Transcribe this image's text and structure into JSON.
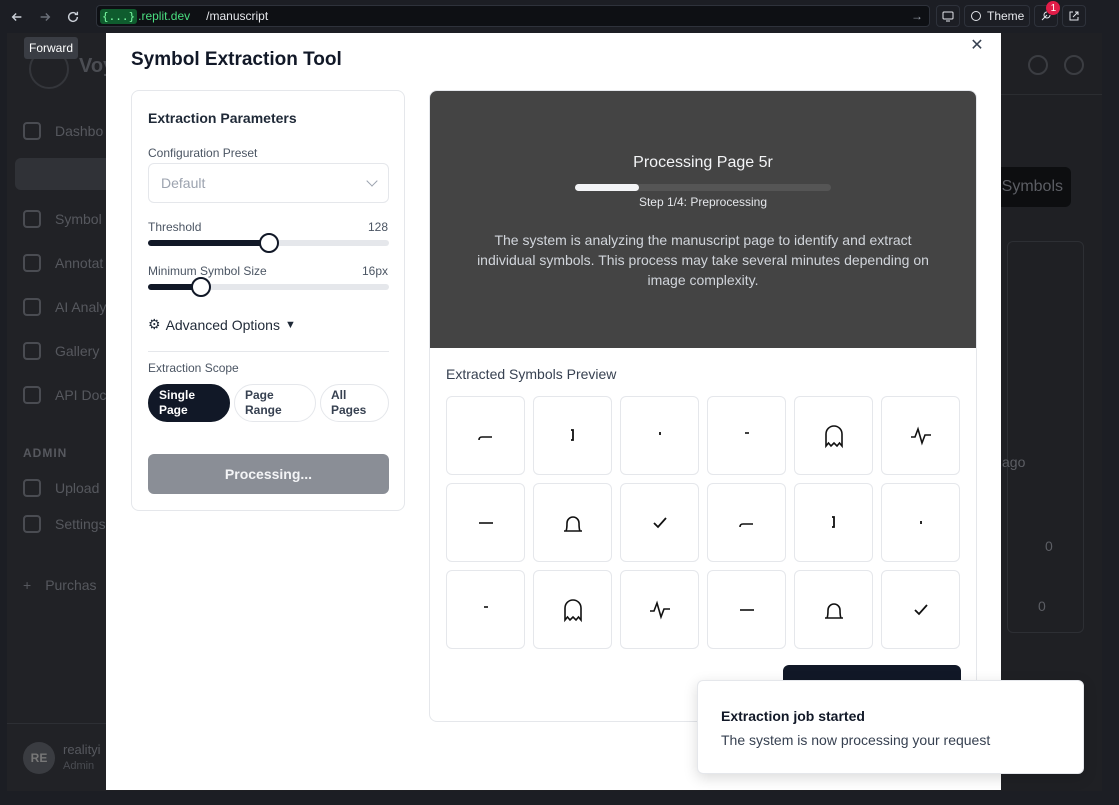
{
  "browser": {
    "url_badge": "{...}",
    "url_domain": ".replit.dev",
    "url_path": "/manuscript",
    "theme_label": "Theme",
    "notification_count": "1",
    "tooltip": "Forward"
  },
  "background_app": {
    "logo_text": "Voy",
    "nav_items": [
      "Dashbo",
      "Symbol",
      "Annotat",
      "AI Analy",
      "Gallery",
      "API Doc"
    ],
    "admin_heading": "ADMIN",
    "admin_items": [
      "Upload",
      "Settings"
    ],
    "purchase_item": "Purchas",
    "user_initials": "RE",
    "user_name": "realityi",
    "user_role": "Admin",
    "symbols_button": "Symbols",
    "card_text_ago": "ago",
    "card_value_1": "0",
    "card_value_2": "0"
  },
  "modal": {
    "title": "Symbol Extraction Tool",
    "params": {
      "title": "Extraction Parameters",
      "preset_label": "Configuration Preset",
      "preset_value": "Default",
      "threshold_label": "Threshold",
      "threshold_value": "128",
      "threshold_fraction": 0.5,
      "min_size_label": "Minimum Symbol Size",
      "min_size_value": "16px",
      "min_size_fraction": 0.22,
      "advanced_label": "Advanced Options",
      "scope_label": "Extraction Scope",
      "scope_options": [
        {
          "line1": "Single",
          "line2": "Page"
        },
        {
          "line1": "Page",
          "line2": "Range"
        },
        {
          "line1": "All",
          "line2": "Pages"
        }
      ],
      "scope_selected": "Single Page",
      "process_button": "Processing..."
    },
    "processing": {
      "title": "Processing Page 5r",
      "progress_fraction": 0.25,
      "step": "Step 1/4: Preprocessing",
      "description": "The system is analyzing the manuscript page to identify and extract individual symbols. This process may take several minutes depending on image complexity."
    },
    "preview": {
      "title": "Extracted Symbols Preview",
      "symbols": [
        "underscore-symbol",
        "bracket-symbol",
        "dot-symbol",
        "dash-symbol",
        "ghost-symbol",
        "wave-symbol",
        "line-symbol",
        "bell-symbol",
        "check-symbol",
        "underscore-symbol",
        "bracket-symbol",
        "tick-symbol",
        "dash-symbol",
        "ghost-symbol",
        "wave-symbol",
        "line-symbol",
        "bell-symbol",
        "check-symbol"
      ]
    }
  },
  "toast": {
    "title": "Extraction job started",
    "body": "The system is now processing your request"
  },
  "colors": {
    "primary": "#111827",
    "processing_panel": "#444444",
    "accent_green": "#4ade80",
    "badge_red": "#e11d48"
  }
}
